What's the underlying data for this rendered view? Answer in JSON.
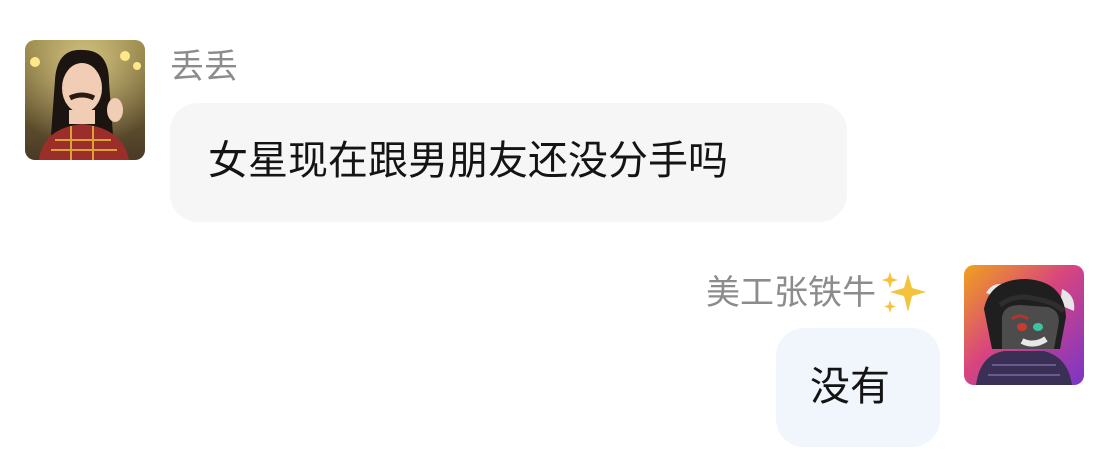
{
  "chat": {
    "messages": [
      {
        "side": "left",
        "sender": "丢丢",
        "text": "女星现在跟男朋友还没分手吗",
        "avatar": "girl-portrait"
      },
      {
        "side": "right",
        "sender": "美工张铁牛",
        "sender_emoji": "sparkles-icon",
        "text": "没有",
        "avatar": "cartoon-goat"
      }
    ]
  },
  "colors": {
    "name_text": "#8c8c8c",
    "bubble_left_bg": "#f6f6f6",
    "bubble_right_bg": "#f1f6fc",
    "message_text": "#141414",
    "sparkle": "#f5c33b"
  }
}
